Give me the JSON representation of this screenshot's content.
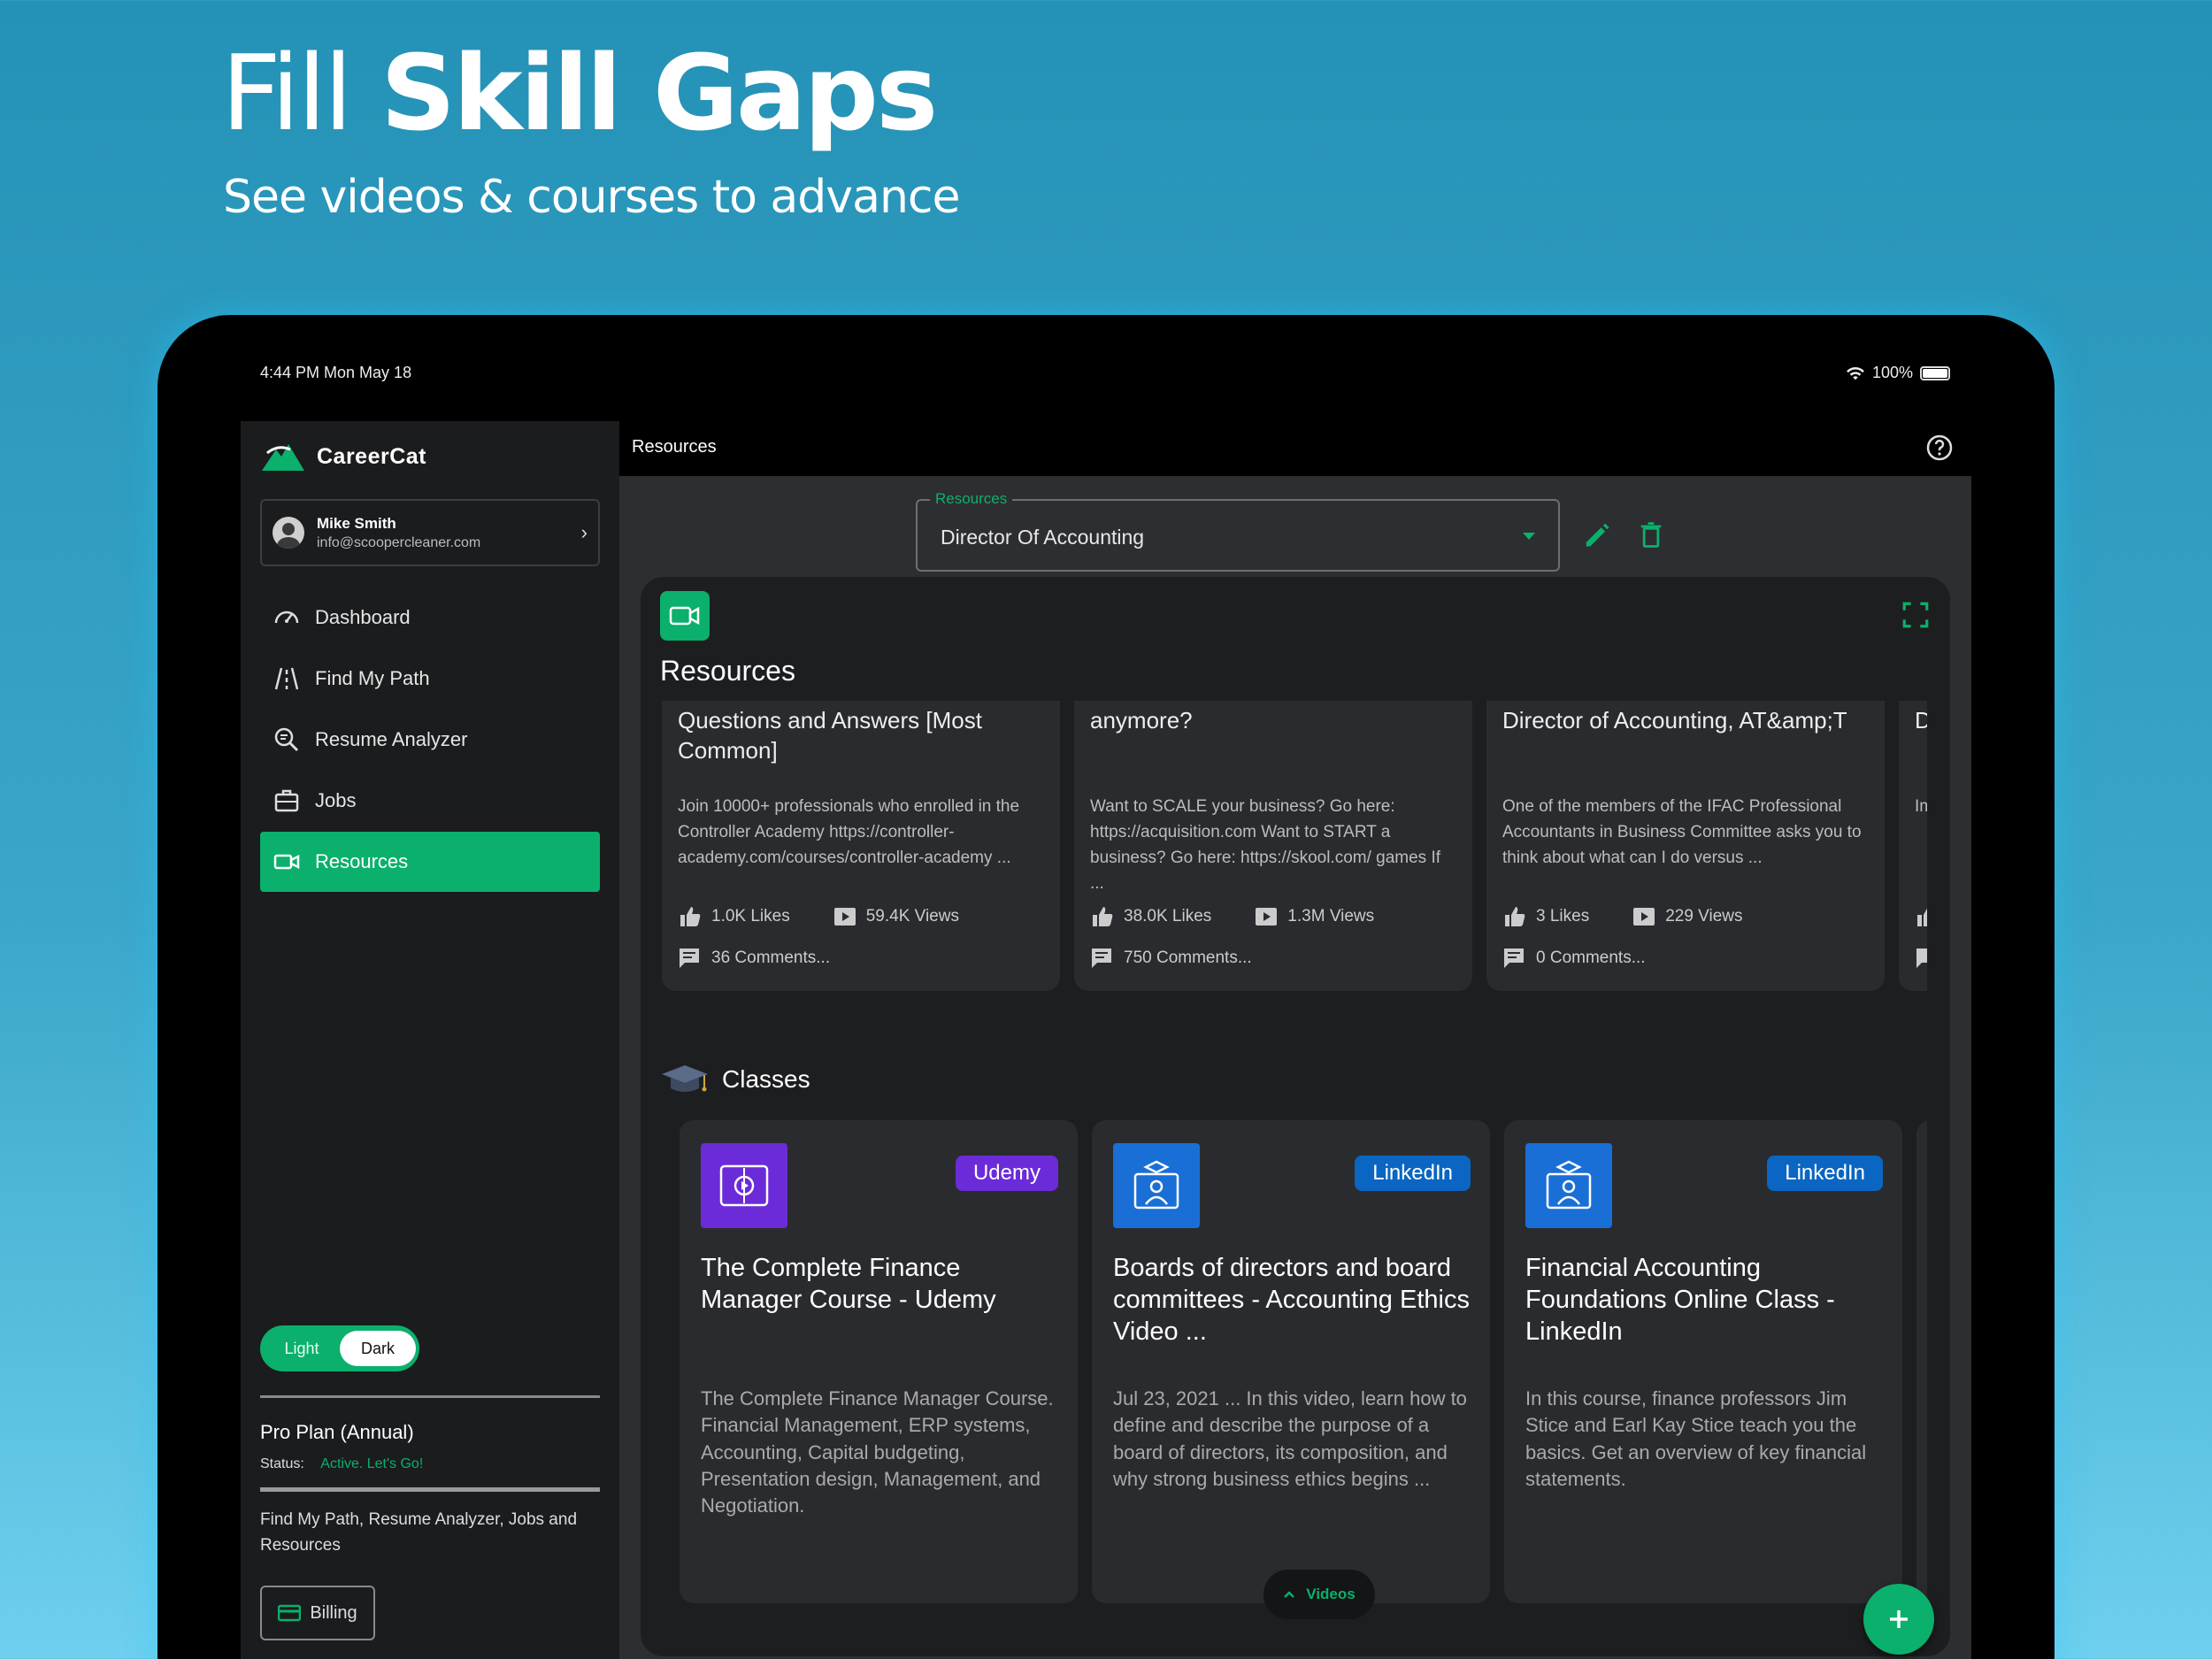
{
  "hero": {
    "title_light": "Fill ",
    "title_bold": "Skill Gaps",
    "subtitle": "See videos & courses to advance"
  },
  "status_bar": {
    "time_date": "4:44 PM   Mon May 18",
    "battery": "100%"
  },
  "sidebar": {
    "brand": "CareerCat",
    "user": {
      "name": "Mike Smith",
      "email": "info@scoopercleaner.com"
    },
    "nav": [
      {
        "label": "Dashboard",
        "icon": "gauge-icon"
      },
      {
        "label": "Find My Path",
        "icon": "road-icon"
      },
      {
        "label": "Resume Analyzer",
        "icon": "search-document-icon"
      },
      {
        "label": "Jobs",
        "icon": "briefcase-icon"
      },
      {
        "label": "Resources",
        "icon": "video-camera-icon",
        "active": true
      }
    ],
    "theme_toggle": {
      "light": "Light",
      "dark": "Dark",
      "selected": "Dark"
    },
    "plan": {
      "title": "Pro Plan (Annual)",
      "status_label": "Status:",
      "status_value": "Active. Let's Go!",
      "description": "Find My Path, Resume Analyzer, Jobs and Resources"
    },
    "billing_label": "Billing"
  },
  "topbar": {
    "title": "Resources"
  },
  "selector": {
    "label": "Resources",
    "value": "Director Of Accounting"
  },
  "panel": {
    "title": "Resources",
    "videos": [
      {
        "title": "Questions and Answers [Most Common]",
        "description": "Join 10000+ professionals who enrolled in the Controller Academy https://controller-academy.com/courses/controller-academy ...",
        "likes": "1.0K Likes",
        "views": "59.4K Views",
        "comments": "36 Comments..."
      },
      {
        "title": "anymore?",
        "description": "Want to SCALE your business? Go here: https://acquisition.com Want to START a business? Go here: https://skool.com/ games If ...",
        "likes": "38.0K Likes",
        "views": "1.3M Views",
        "comments": "750 Comments..."
      },
      {
        "title": "Director of Accounting, AT&amp;T",
        "description": "One of the members of the IFAC Professional Accountants in Business Committee asks you to think about what can I do versus ...",
        "likes": "3 Likes",
        "views": "229 Views",
        "comments": "0 Comments..."
      },
      {
        "title": "Di Ar",
        "description": "Im Di Yo jo",
        "likes": "",
        "views": "",
        "comments": ""
      }
    ],
    "classes_title": "Classes",
    "classes": [
      {
        "provider": "Udemy",
        "title": "The Complete Finance Manager Course - Udemy",
        "description": "The Complete Finance Manager Course. Financial Management, ERP systems, Accounting, Capital budgeting, Presentation design, Management, and Negotiation."
      },
      {
        "provider": "LinkedIn",
        "title": "Boards of directors and board committees - Accounting Ethics Video ...",
        "description": "Jul 23, 2021 ... In this video, learn how to define and describe the purpose of a board of directors, its composition, and why strong business ethics begins ..."
      },
      {
        "provider": "LinkedIn",
        "title": "Financial Accounting Foundations Online Class - LinkedIn",
        "description": "In this course, finance professors Jim Stice and Earl Kay Stice teach you the basics. Get an overview of key financial statements."
      }
    ],
    "videos_pill": "Videos"
  },
  "colors": {
    "accent": "#0bb06c",
    "udemy": "#6c2bd9",
    "linkedin": "#0a66c2"
  }
}
